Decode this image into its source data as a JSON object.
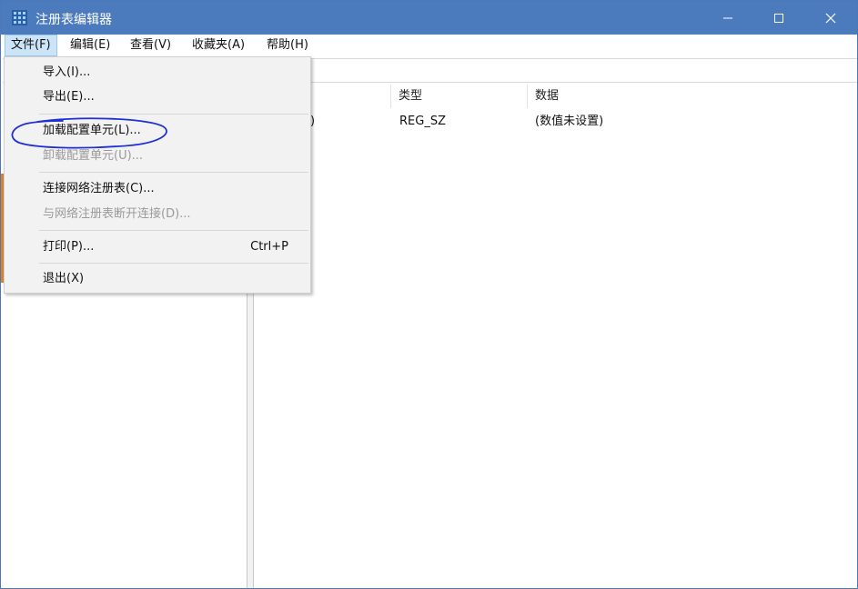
{
  "window": {
    "title": "注册表编辑器",
    "icon": "registry-editor-icon",
    "controls": {
      "minimize": "minimize-icon",
      "maximize": "maximize-icon",
      "close": "close-icon"
    }
  },
  "menubar": {
    "items": [
      {
        "label": "文件(F)",
        "active": true
      },
      {
        "label": "编辑(E)"
      },
      {
        "label": "查看(V)"
      },
      {
        "label": "收藏夹(A)"
      },
      {
        "label": "帮助(H)"
      }
    ]
  },
  "list": {
    "columns": [
      "类型",
      "数据"
    ],
    "rows": [
      {
        "name_fragment": ")",
        "type": "REG_SZ",
        "data": "(数值未设置)"
      }
    ]
  },
  "file_menu": {
    "items": [
      {
        "label": "导入(I)...",
        "enabled": true
      },
      {
        "label": "导出(E)...",
        "enabled": true
      },
      {
        "label": "加载配置单元(L)...",
        "enabled": true,
        "highlighted_annotation": true
      },
      {
        "label": "卸载配置单元(U)...",
        "enabled": false
      },
      {
        "label": "连接网络注册表(C)...",
        "enabled": true
      },
      {
        "label": "与网络注册表断开连接(D)...",
        "enabled": false
      },
      {
        "label": "打印(P)...",
        "shortcut": "Ctrl+P",
        "enabled": true
      },
      {
        "label": "退出(X)",
        "enabled": true
      }
    ]
  },
  "colors": {
    "titlebar": "#4b7bbd",
    "menu_active": "#cce4f7",
    "annotation_ink": "#1f2fd6",
    "disabled_text": "#9a9a9a"
  }
}
